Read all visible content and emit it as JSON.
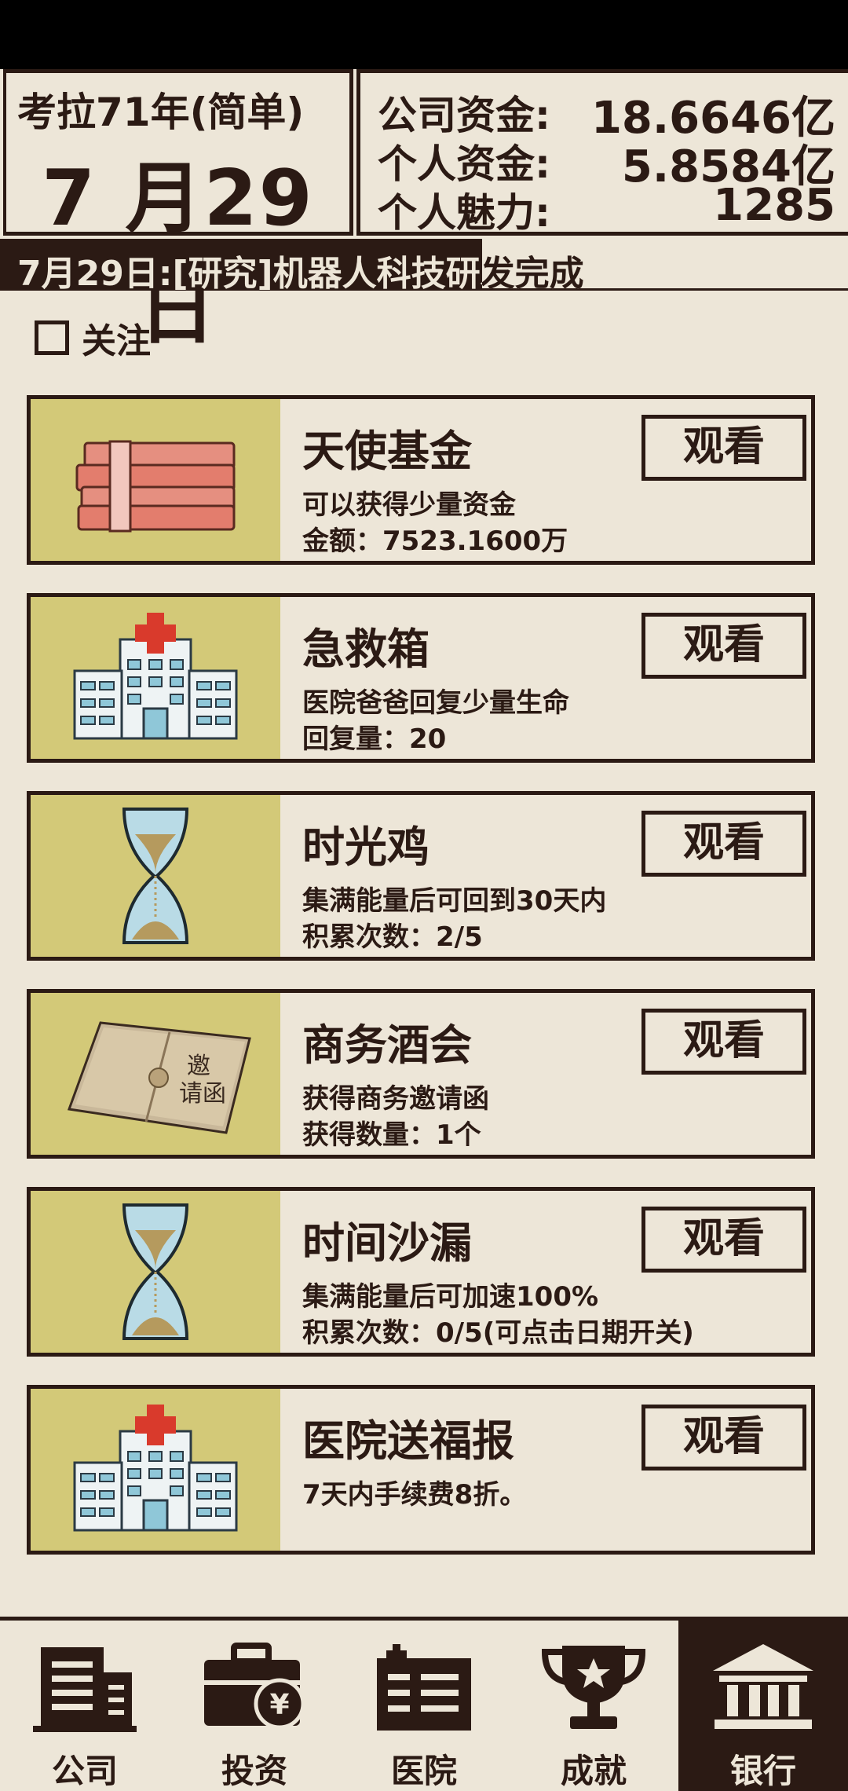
{
  "header": {
    "year_label": "考拉71年(简单)",
    "date": "7 月29 日",
    "stats": [
      {
        "label": "公司资金:",
        "value": "18.6646亿"
      },
      {
        "label": "个人资金:",
        "value": "5.8584亿"
      },
      {
        "label": "个人魅力:",
        "value": "1285"
      }
    ]
  },
  "news": {
    "text": "7月29日:[研究]机器人科技研发完成"
  },
  "follow": {
    "label": "关注",
    "checked": false
  },
  "cards": [
    {
      "title": "天使基金",
      "desc1": "可以获得少量资金",
      "desc2": "金额：7523.1600万",
      "button": "观看",
      "icon": "money-stack-icon"
    },
    {
      "title": "急救箱",
      "desc1": "医院爸爸回复少量生命",
      "desc2": "回复量：20",
      "button": "观看",
      "icon": "hospital-icon"
    },
    {
      "title": "时光鸡",
      "desc1": "集满能量后可回到30天内",
      "desc2": "积累次数：2/5",
      "button": "观看",
      "icon": "hourglass-icon"
    },
    {
      "title": "商务酒会",
      "desc1": "获得商务邀请函",
      "desc2": "获得数量：1个",
      "button": "观看",
      "icon": "invitation-icon"
    },
    {
      "title": "时间沙漏",
      "desc1": "集满能量后可加速100%",
      "desc2": "积累次数：0/5(可点击日期开关)",
      "button": "观看",
      "icon": "hourglass-icon"
    },
    {
      "title": "医院送福报",
      "desc1": "7天内手续费8折。",
      "desc2": "",
      "button": "观看",
      "icon": "hospital-icon"
    }
  ],
  "nav": [
    {
      "label": "公司",
      "icon": "company-icon",
      "active": false
    },
    {
      "label": "投资",
      "icon": "briefcase-icon",
      "active": false
    },
    {
      "label": "医院",
      "icon": "hospital-building-icon",
      "active": false
    },
    {
      "label": "成就",
      "icon": "trophy-icon",
      "active": false
    },
    {
      "label": "银行",
      "icon": "bank-icon",
      "active": true
    }
  ],
  "colors": {
    "background": "#ede6d8",
    "dark": "#2b1a14",
    "card_image_bg": "#d3c978"
  }
}
